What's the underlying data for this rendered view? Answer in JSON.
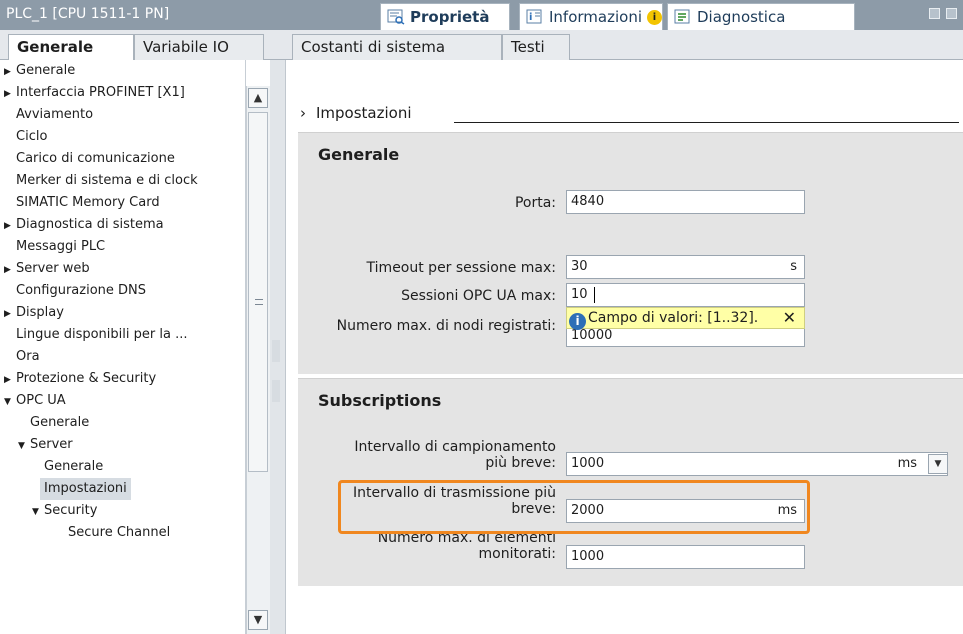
{
  "window": {
    "title": "PLC_1 [CPU 1511-1 PN]"
  },
  "panel_tabs": [
    {
      "label": "Proprietà",
      "icon": "properties-icon",
      "active": true
    },
    {
      "label": "Informazioni",
      "icon": "info-icon",
      "badge_icon": "info-badge-icon"
    },
    {
      "label": "Diagnostica",
      "icon": "diagnostics-icon"
    }
  ],
  "window_buttons": [
    "restore-icon",
    "menu-icon"
  ],
  "sub_tabs": [
    {
      "label": "Generale",
      "active": true
    },
    {
      "label": "Variabile IO"
    },
    {
      "label": "Costanti di sistema"
    },
    {
      "label": "Testi"
    }
  ],
  "tree": [
    {
      "label": "Generale",
      "arrow": "collapsed"
    },
    {
      "label": "Interfaccia PROFINET [X1]",
      "arrow": "collapsed"
    },
    {
      "label": "Avviamento"
    },
    {
      "label": "Ciclo"
    },
    {
      "label": "Carico di comunicazione"
    },
    {
      "label": "Merker di sistema e di clock"
    },
    {
      "label": "SIMATIC Memory Card"
    },
    {
      "label": "Diagnostica di sistema",
      "arrow": "collapsed"
    },
    {
      "label": "Messaggi PLC"
    },
    {
      "label": "Server web",
      "arrow": "collapsed"
    },
    {
      "label": "Configurazione DNS"
    },
    {
      "label": "Display",
      "arrow": "collapsed"
    },
    {
      "label": "Lingue disponibili per la ..."
    },
    {
      "label": "Ora"
    },
    {
      "label": "Protezione & Security",
      "arrow": "collapsed"
    },
    {
      "label": "OPC UA",
      "arrow": "expanded"
    },
    {
      "label": "Generale"
    },
    {
      "label": "Server",
      "arrow": "expanded"
    },
    {
      "label": "Generale"
    },
    {
      "label": "Impostazioni",
      "selected": true
    },
    {
      "label": "Security",
      "arrow": "expanded"
    },
    {
      "label": "Secure Channel"
    }
  ],
  "content": {
    "breadcrumb_arrow": "›",
    "breadcrumb": "Impostazioni",
    "general": {
      "heading": "Generale",
      "port_label": "Porta:",
      "port_value": "4840",
      "timeout_label": "Timeout per sessione max:",
      "timeout_value": "30",
      "timeout_unit": "s",
      "sessions_label": "Sessioni OPC UA max:",
      "sessions_value": "10",
      "nodes_label": "Numero max. di nodi registrati:",
      "nodes_value": "10000",
      "tooltip_text": "Campo di valori: [1..32].",
      "tooltip_info_glyph": "i",
      "tooltip_close": "✕"
    },
    "subscriptions": {
      "heading": "Subscriptions",
      "sampling_label_1": "Intervallo di campionamento",
      "sampling_label_2": "più breve:",
      "sampling_value": "1000",
      "sampling_unit": "ms",
      "publish_label_1": "Intervallo di trasmissione più",
      "publish_label_2": "breve:",
      "publish_value": "2000",
      "publish_unit": "ms",
      "monitored_label_1": "Numero max. di elementi",
      "monitored_label_2": "monitorati:",
      "monitored_value": "1000"
    }
  },
  "colors": {
    "title_bar": "#8d9ba8",
    "section_bg": "#e4e4e4",
    "highlight": "#f0871f",
    "tooltip_bg": "#ffffa6",
    "info_blue": "#2d6fb7"
  }
}
